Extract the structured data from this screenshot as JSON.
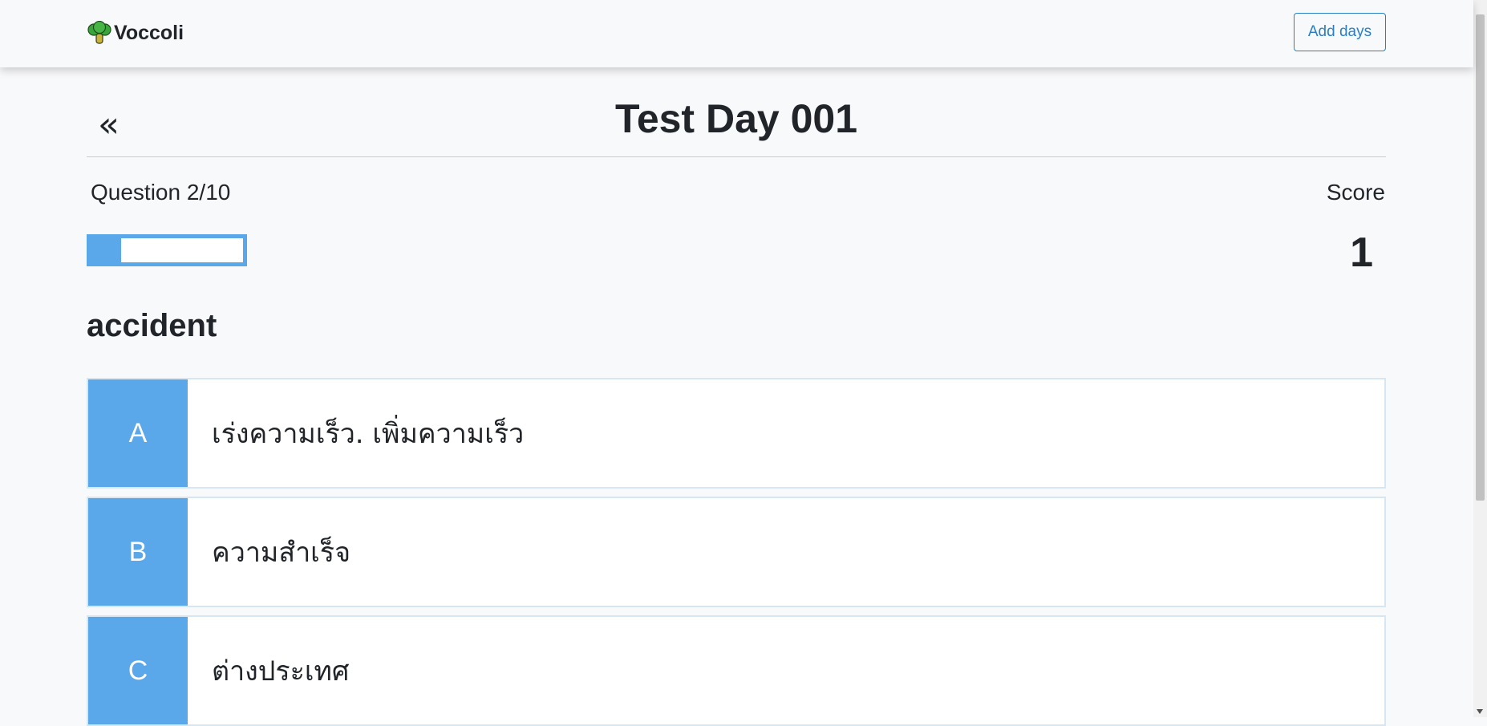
{
  "navbar": {
    "brand": "Voccoli",
    "add_days_label": "Add days"
  },
  "test": {
    "back_label": "«",
    "title": "Test Day 001",
    "question_counter": "Question 2/10",
    "score_label": "Score",
    "score_value": "1",
    "progress_fraction": 0.2,
    "word": "accident"
  },
  "options": [
    {
      "letter": "A",
      "text": "เร่งความเร็ว. เพิ่มความเร็ว"
    },
    {
      "letter": "B",
      "text": "ความสำเร็จ"
    },
    {
      "letter": "C",
      "text": "ต่างประเทศ"
    }
  ],
  "colors": {
    "accent": "#5aa8ea",
    "button_outline": "#2a7fc4",
    "background": "#f8f9fa"
  },
  "icons": {
    "brand": "broccoli-icon",
    "scroll_down": "chevron-down-icon"
  }
}
